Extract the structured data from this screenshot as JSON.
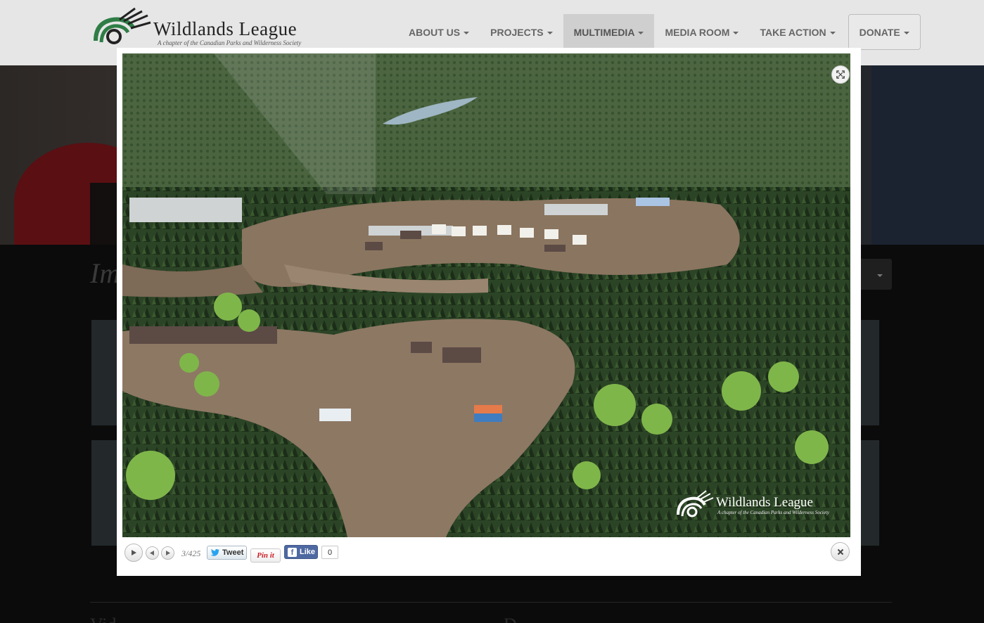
{
  "header": {
    "logo_name": "Wildlands League",
    "logo_tagline": "A chapter of the Canadian Parks and Wilderness Society",
    "nav": [
      {
        "label": "ABOUT US"
      },
      {
        "label": "PROJECTS"
      },
      {
        "label": "MULTIMEDIA"
      },
      {
        "label": "MEDIA ROOM"
      },
      {
        "label": "TAKE ACTION"
      },
      {
        "label": "DONATE"
      }
    ],
    "active_nav": "MULTIMEDIA"
  },
  "page": {
    "heading_partial": "Im",
    "bottom_heading_left": "Vid",
    "bottom_heading_right": "D"
  },
  "lightbox": {
    "watermark_name": "Wildlands League",
    "watermark_tagline": "A chapter of the Canadian Parks and Wilderness Society",
    "counter": "3/425",
    "tweet_label": "Tweet",
    "pin_label": "Pin it",
    "like_label": "Like",
    "like_count": "0",
    "icons": [
      "expand-icon",
      "play-icon",
      "prev-icon",
      "next-icon",
      "twitter-icon",
      "facebook-icon",
      "close-icon"
    ]
  },
  "colors": {
    "header_bg": "#e6e6e6",
    "active_nav_bg": "#cfcfcf",
    "page_bg": "#0b0b0b",
    "lightbox_bg": "#ffffff",
    "facebook_blue": "#4e69a2",
    "pinterest_red": "#cb2027"
  }
}
